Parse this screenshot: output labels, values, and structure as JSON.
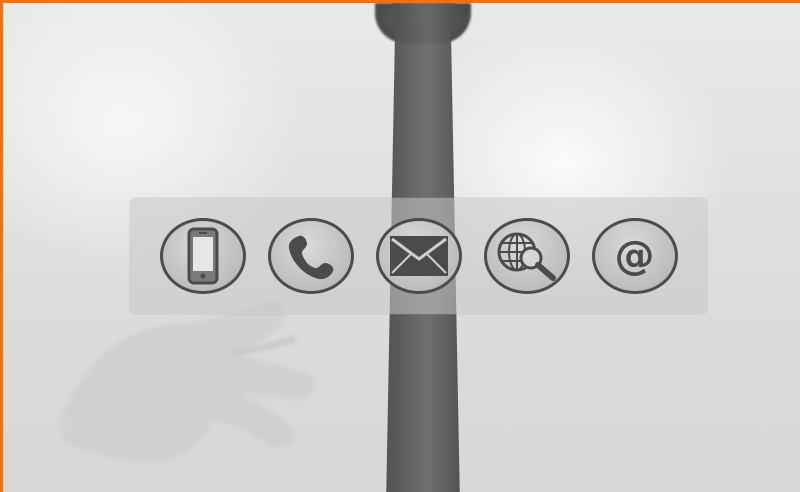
{
  "frame": {
    "accent": "#E8731F"
  },
  "panel": {
    "icons": [
      {
        "name": "mobile-phone-icon"
      },
      {
        "name": "telephone-icon"
      },
      {
        "name": "envelope-icon"
      },
      {
        "name": "globe-search-icon"
      },
      {
        "name": "at-sign-icon",
        "glyph": "@"
      }
    ]
  }
}
